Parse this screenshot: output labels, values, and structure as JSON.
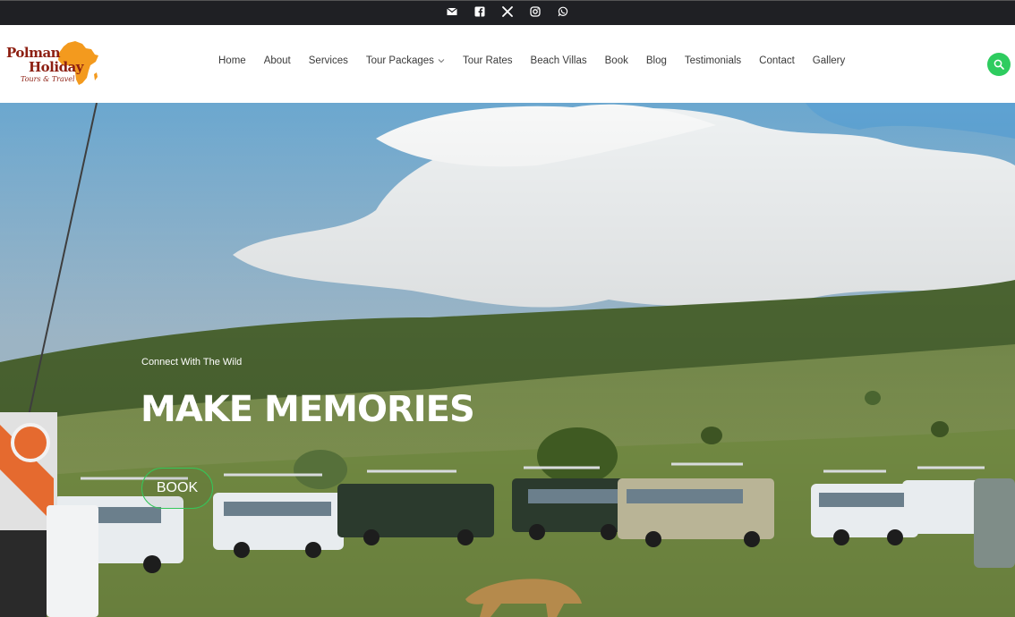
{
  "topbar": {
    "social_icons": [
      "envelope-icon",
      "facebook-icon",
      "x-twitter-icon",
      "instagram-icon",
      "whatsapp-icon"
    ]
  },
  "brand": {
    "line1": "Polman",
    "line2": "Holiday",
    "tagline": "Tours & Travel",
    "primary_color": "#8d1f12",
    "accent_color": "#f39a1e"
  },
  "nav": {
    "items": [
      {
        "label": "Home"
      },
      {
        "label": "About"
      },
      {
        "label": "Services"
      },
      {
        "label": "Tour Packages",
        "has_dropdown": true
      },
      {
        "label": "Tour Rates"
      },
      {
        "label": "Beach Villas"
      },
      {
        "label": "Book"
      },
      {
        "label": "Blog"
      },
      {
        "label": "Testimonials"
      },
      {
        "label": "Contact"
      },
      {
        "label": "Gallery"
      }
    ]
  },
  "search": {
    "icon": "search-icon",
    "color": "#2ecc5f"
  },
  "hero": {
    "subtitle": "Connect With The Wild",
    "title": "MAKE MEMORIES",
    "button_label": "BOOK",
    "button_border_color": "#34c75a"
  }
}
